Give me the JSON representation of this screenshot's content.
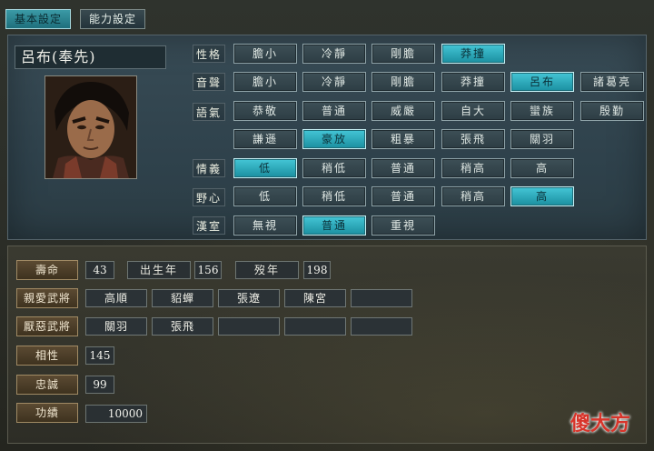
{
  "tabs": {
    "basic": "基本設定",
    "ability": "能力設定"
  },
  "officer": {
    "name": "呂布(奉先)"
  },
  "rows": {
    "personality": {
      "label": "性格",
      "options": [
        "膽小",
        "冷靜",
        "剛膽",
        "莽撞"
      ],
      "selected": "莽撞"
    },
    "voice": {
      "label": "音聲",
      "options": [
        "膽小",
        "冷靜",
        "剛膽",
        "莽撞",
        "呂布",
        "諸葛亮"
      ],
      "selected": "呂布"
    },
    "tone": {
      "label": "語氣",
      "options": [
        "恭敬",
        "普通",
        "威嚴",
        "自大",
        "蠻族",
        "殷勤",
        "謙遜",
        "豪放",
        "粗暴",
        "張飛",
        "關羽"
      ],
      "selected": "豪放"
    },
    "loyalty": {
      "label": "情義",
      "options": [
        "低",
        "稍低",
        "普通",
        "稍高",
        "高"
      ],
      "selected": "低"
    },
    "ambition": {
      "label": "野心",
      "options": [
        "低",
        "稍低",
        "普通",
        "稍高",
        "高"
      ],
      "selected": "高"
    },
    "han": {
      "label": "漢室",
      "options": [
        "無視",
        "普通",
        "重視"
      ],
      "selected": "普通"
    }
  },
  "stats": {
    "lifespan_label": "壽命",
    "lifespan": "43",
    "birth_label": "出生年",
    "birth": "156",
    "death_label": "歿年",
    "death": "198",
    "liked_label": "親愛武將",
    "liked": [
      "高順",
      "貂蟬",
      "張遼",
      "陳宮",
      ""
    ],
    "disliked_label": "厭惡武將",
    "disliked": [
      "關羽",
      "張飛",
      "",
      "",
      ""
    ],
    "compat_label": "相性",
    "compat": "145",
    "loyal_label": "忠誠",
    "loyal": "99",
    "merit_label": "功績",
    "merit": "10000"
  },
  "watermark": "傻大方"
}
